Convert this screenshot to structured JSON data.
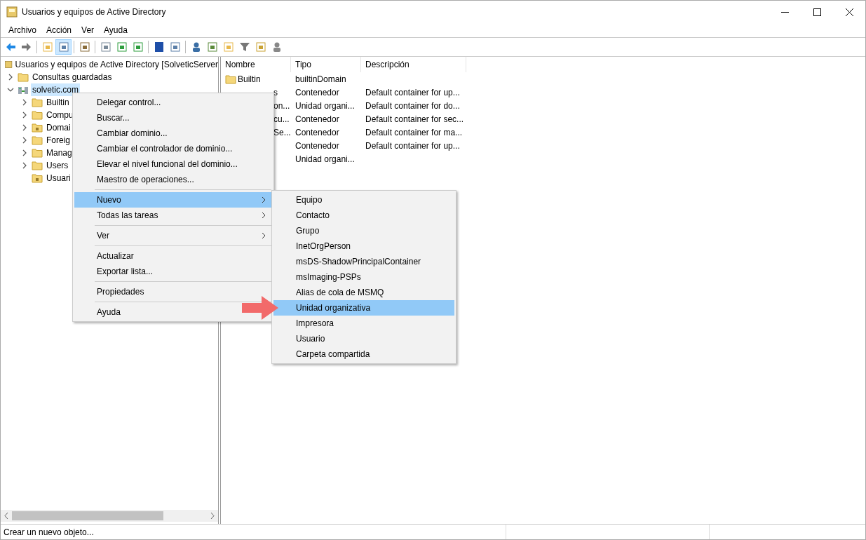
{
  "window": {
    "title": "Usuarios y equipos de Active Directory"
  },
  "menu_bar": [
    "Archivo",
    "Acción",
    "Ver",
    "Ayuda"
  ],
  "tree": {
    "label": "Usuarios y equipos de Active Directory [SolveticServer",
    "children": [
      {
        "label": "Consultas guardadas",
        "kind": "folder",
        "expandable": true,
        "expanded": false,
        "selected": false
      },
      {
        "label": "solvetic.com",
        "kind": "domain",
        "expandable": true,
        "expanded": true,
        "selected": true,
        "children": [
          {
            "label": "Builtin",
            "kind": "folder",
            "expandable": true,
            "expanded": false,
            "selected": false
          },
          {
            "label": "Compu",
            "kind": "folder",
            "expandable": true,
            "expanded": false,
            "selected": false
          },
          {
            "label": "Domai",
            "kind": "ou",
            "expandable": true,
            "expanded": false,
            "selected": false
          },
          {
            "label": "Foreig",
            "kind": "folder",
            "expandable": true,
            "expanded": false,
            "selected": false
          },
          {
            "label": "Manag",
            "kind": "folder",
            "expandable": true,
            "expanded": false,
            "selected": false
          },
          {
            "label": "Users",
            "kind": "folder",
            "expandable": true,
            "expanded": false,
            "selected": false
          },
          {
            "label": "Usuari",
            "kind": "ou",
            "expandable": false,
            "expanded": false,
            "selected": false
          }
        ]
      }
    ]
  },
  "list": {
    "columns": [
      "Nombre",
      "Tipo",
      "Descripción"
    ],
    "rows": [
      {
        "name": "Builtin",
        "icon": true,
        "type": "builtinDomain"
      },
      {
        "name": "s",
        "icon": false,
        "type": "Contenedor",
        "description": "Default container for up..."
      },
      {
        "name": "on...",
        "icon": false,
        "type": "Unidad organi...",
        "description": "Default container for do..."
      },
      {
        "name": "cu...",
        "icon": false,
        "type": "Contenedor",
        "description": "Default container for sec..."
      },
      {
        "name": "Se...",
        "icon": false,
        "type": "Contenedor",
        "description": "Default container for ma..."
      },
      {
        "type": "Contenedor",
        "icon": false,
        "description": "Default container for up..."
      },
      {
        "type": "Unidad organi...",
        "icon": false
      }
    ]
  },
  "context_menu": {
    "items": [
      {
        "kind": "item",
        "label": "Delegar control...",
        "submenu": false,
        "selected": false
      },
      {
        "kind": "item",
        "label": "Buscar...",
        "submenu": false,
        "selected": false
      },
      {
        "kind": "item",
        "label": "Cambiar dominio...",
        "submenu": false,
        "selected": false
      },
      {
        "kind": "item",
        "label": "Cambiar el controlador de dominio...",
        "submenu": false,
        "selected": false
      },
      {
        "kind": "item",
        "label": "Elevar el nivel funcional del dominio...",
        "submenu": false,
        "selected": false
      },
      {
        "kind": "item",
        "label": "Maestro de operaciones...",
        "submenu": false,
        "selected": false
      },
      {
        "kind": "separator"
      },
      {
        "kind": "item",
        "label": "Nuevo",
        "submenu": true,
        "selected": true
      },
      {
        "kind": "item",
        "label": "Todas las tareas",
        "submenu": true,
        "selected": false
      },
      {
        "kind": "separator"
      },
      {
        "kind": "item",
        "label": "Ver",
        "submenu": true,
        "selected": false
      },
      {
        "kind": "separator"
      },
      {
        "kind": "item",
        "label": "Actualizar",
        "submenu": false,
        "selected": false
      },
      {
        "kind": "item",
        "label": "Exportar lista...",
        "submenu": false,
        "selected": false
      },
      {
        "kind": "separator"
      },
      {
        "kind": "item",
        "label": "Propiedades",
        "submenu": false,
        "selected": false
      },
      {
        "kind": "separator"
      },
      {
        "kind": "item",
        "label": "Ayuda",
        "submenu": false,
        "selected": false
      }
    ]
  },
  "submenu": {
    "items": [
      {
        "label": "Equipo",
        "selected": false
      },
      {
        "label": "Contacto",
        "selected": false
      },
      {
        "label": "Grupo",
        "selected": false
      },
      {
        "label": "InetOrgPerson",
        "selected": false
      },
      {
        "label": "msDS-ShadowPrincipalContainer",
        "selected": false
      },
      {
        "label": "msImaging-PSPs",
        "selected": false
      },
      {
        "label": "Alias de cola de MSMQ",
        "selected": false
      },
      {
        "label": "Unidad organizativa",
        "selected": true
      },
      {
        "label": "Impresora",
        "selected": false
      },
      {
        "label": "Usuario",
        "selected": false
      },
      {
        "label": "Carpeta compartida",
        "selected": false
      }
    ]
  },
  "status_bar": {
    "text": "Crear un nuevo objeto..."
  }
}
